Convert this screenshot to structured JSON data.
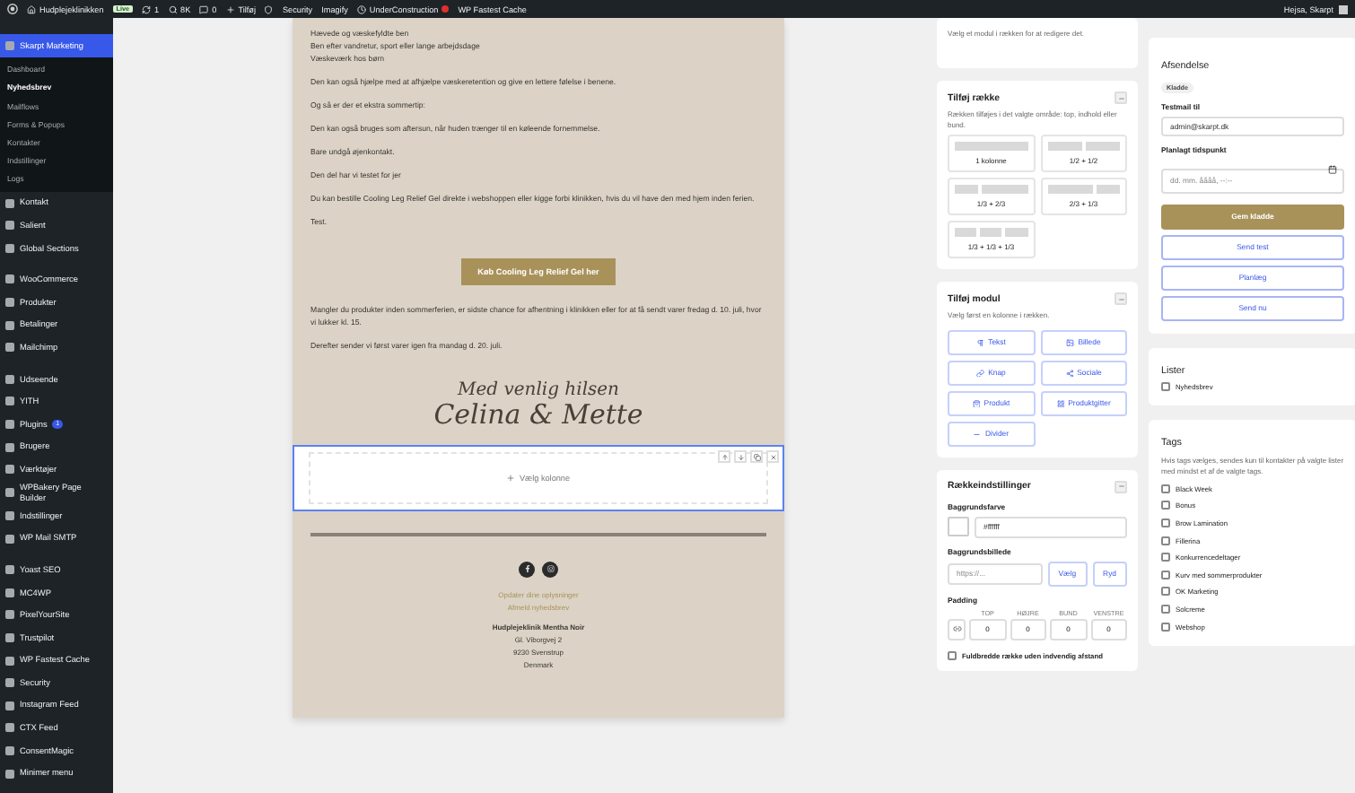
{
  "admin_bar": {
    "site_name": "Hudplejeklinikken",
    "live_badge": "Live",
    "updates": "1",
    "stats": "8K",
    "comments": "0",
    "new": "Tilføj",
    "plugins": [
      "Security",
      "Imagify",
      "UnderConstruction",
      "WP Fastest Cache"
    ],
    "greeting": "Hejsa, Skarpt"
  },
  "sidebar": {
    "groups": [
      [
        {
          "label": "Skarpt Marketing",
          "selected": true,
          "children": [
            {
              "label": "Dashboard",
              "selected": false
            },
            {
              "label": "Nyhedsbrev",
              "selected": true
            },
            {
              "label": "Mailflows",
              "selected": false
            },
            {
              "label": "Forms & Popups",
              "selected": false
            },
            {
              "label": "Kontakter",
              "selected": false
            },
            {
              "label": "Indstillinger",
              "selected": false
            },
            {
              "label": "Logs",
              "selected": false
            }
          ]
        },
        {
          "label": "Kontakt",
          "selected": false
        },
        {
          "label": "Salient",
          "selected": false
        },
        {
          "label": "Global Sections",
          "selected": false
        }
      ],
      [
        {
          "label": "WooCommerce",
          "selected": false
        },
        {
          "label": "Produkter",
          "selected": false
        },
        {
          "label": "Betalinger",
          "selected": false
        },
        {
          "label": "Mailchimp",
          "selected": false
        }
      ],
      [
        {
          "label": "Udseende",
          "selected": false
        },
        {
          "label": "YITH",
          "selected": false
        },
        {
          "label": "Plugins",
          "selected": false,
          "badge": "1"
        },
        {
          "label": "Brugere",
          "selected": false
        },
        {
          "label": "Værktøjer",
          "selected": false
        },
        {
          "label": "WPBakery Page Builder",
          "selected": false
        },
        {
          "label": "Indstillinger",
          "selected": false
        },
        {
          "label": "WP Mail SMTP",
          "selected": false
        }
      ],
      [
        {
          "label": "Yoast SEO",
          "selected": false
        },
        {
          "label": "MC4WP",
          "selected": false
        },
        {
          "label": "PixelYourSite",
          "selected": false
        },
        {
          "label": "Trustpilot",
          "selected": false
        },
        {
          "label": "WP Fastest Cache",
          "selected": false
        },
        {
          "label": "Security",
          "selected": false
        },
        {
          "label": "Instagram Feed",
          "selected": false
        },
        {
          "label": "CTX Feed",
          "selected": false
        },
        {
          "label": "ConsentMagic",
          "selected": false
        },
        {
          "label": "Minimer menu",
          "selected": false
        }
      ]
    ]
  },
  "email": {
    "intro_lines": [
      "Hævede og væskefyldte ben",
      "Ben efter vandretur, sport eller lange arbejdsdage",
      "Væskeværk hos børn"
    ],
    "paragraphs": [
      "Den kan også hjælpe med at afhjælpe væskeretention og give en lettere følelse i benene.",
      "Og så er der et ekstra sommertip:",
      "Den kan også bruges som aftersun, når huden trænger til en køleende fornemmelse.",
      "Bare undgå øjenkontakt.",
      "Den del har vi testet for jer",
      "Du kan bestille Cooling Leg Relief Gel direkte i webshoppen eller kigge forbi klinikken, hvis du vil have den med hjem inden ferien.",
      "Test."
    ],
    "cta": "Køb Cooling Leg Relief Gel her",
    "closing": [
      "Mangler du produkter inden sommerferien, er sidste chance for afhentning i klinikken eller for at få sendt varer fredag d. 10. juli, hvor vi lukker kl. 15.",
      "Derefter sender vi først varer igen fra mandag d. 20. juli."
    ],
    "signature": {
      "greeting": "Med venlig hilsen",
      "names": "Celina & Mette"
    },
    "selected_row": {
      "label": "Vælg kolonne"
    },
    "footer": {
      "links": [
        "Opdater dine oplysninger",
        "Afmeld nyhedsbrev"
      ],
      "company": "Hudplejeklinik Mentha Noir",
      "address": [
        "Gl. Viborgvej 2",
        "9230 Svenstrup",
        "Denmark"
      ]
    }
  },
  "module_hint": "Vælg et modul i rækken for at redigere det.",
  "add_row": {
    "title": "Tilføj række",
    "hint": "Rækken tilføjes i det valgte område: top, indhold eller bund.",
    "layouts": [
      {
        "label": "1 kolonne",
        "kind": "one"
      },
      {
        "label": "1/2 + 1/2",
        "kind": "halves"
      },
      {
        "label": "1/3 + 2/3",
        "kind": "third_twothirds"
      },
      {
        "label": "2/3 + 1/3",
        "kind": "twothirds_third"
      },
      {
        "label": "1/3 + 1/3 + 1/3",
        "kind": "thirds"
      }
    ]
  },
  "add_module": {
    "title": "Tilføj modul",
    "hint": "Vælg først en kolonne i rækken.",
    "modules": [
      {
        "label": "Tekst",
        "kind": "text"
      },
      {
        "label": "Billede",
        "kind": "image"
      },
      {
        "label": "Knap",
        "kind": "button"
      },
      {
        "label": "Sociale",
        "kind": "social"
      },
      {
        "label": "Produkt",
        "kind": "product"
      },
      {
        "label": "Produktgitter",
        "kind": "product_grid"
      },
      {
        "label": "Divider",
        "kind": "divider"
      }
    ]
  },
  "row_settings": {
    "title": "Rækkeindstillinger",
    "bg_color_label": "Baggrundsfarve",
    "bg_color_value": "#ffffff",
    "bg_image_label": "Baggrundsbillede",
    "bg_image_placeholder": "https://...",
    "choose": "Vælg",
    "clear": "Ryd",
    "padding_label": "Padding",
    "padding": [
      {
        "label": "TOP",
        "value": "0"
      },
      {
        "label": "HØJRE",
        "value": "0"
      },
      {
        "label": "BUND",
        "value": "0"
      },
      {
        "label": "VENSTRE",
        "value": "0"
      }
    ],
    "full_width": {
      "label": "Fuldbredde række uden indvendig afstand",
      "checked": false
    }
  },
  "sending": {
    "title": "Afsendelse",
    "status": "Kladde",
    "test_label": "Testmail til",
    "test_value": "admin@skarpt.dk",
    "schedule_label": "Planlagt tidspunkt",
    "schedule_placeholder": "dd. mm. åååå, --:--",
    "buttons": [
      {
        "label": "Gem kladde",
        "kind": "primary"
      },
      {
        "label": "Send test",
        "kind": "secondary"
      },
      {
        "label": "Planlæg",
        "kind": "secondary"
      },
      {
        "label": "Send nu",
        "kind": "secondary"
      }
    ]
  },
  "lists": {
    "title": "Lister",
    "items": [
      {
        "label": "Nyhedsbrev",
        "checked": false
      }
    ]
  },
  "tags": {
    "title": "Tags",
    "hint": "Hvis tags vælges, sendes kun til kontakter på valgte lister med mindst et af de valgte tags.",
    "items": [
      {
        "label": "Black Week",
        "checked": false
      },
      {
        "label": "Bonus",
        "checked": false
      },
      {
        "label": "Brow Lamination",
        "checked": false
      },
      {
        "label": "Fillerina",
        "checked": false
      },
      {
        "label": "Konkurrencedeltager",
        "checked": false
      },
      {
        "label": "Kurv med sommerprodukter",
        "checked": false
      },
      {
        "label": "OK Marketing",
        "checked": false
      },
      {
        "label": "Solcreme",
        "checked": false
      },
      {
        "label": "Webshop",
        "checked": false
      }
    ]
  }
}
